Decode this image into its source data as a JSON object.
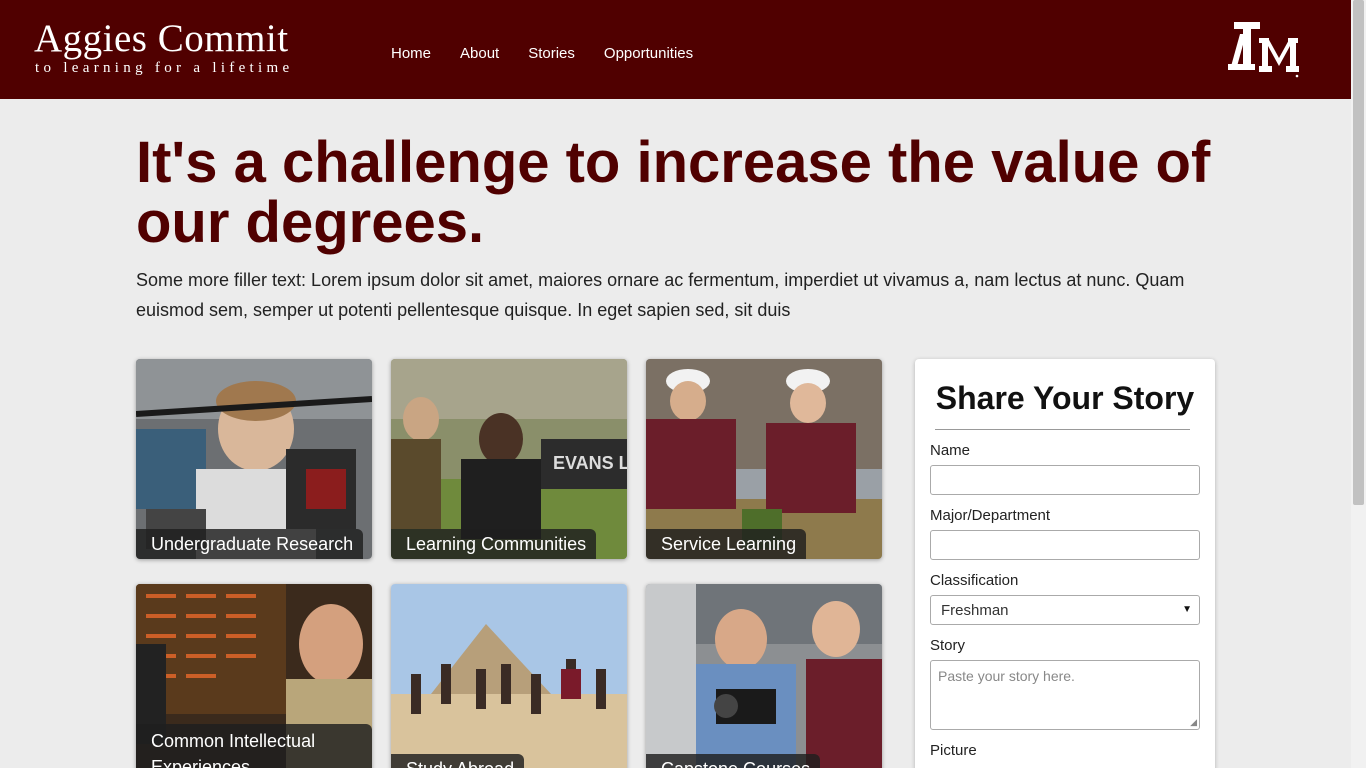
{
  "header": {
    "logo_title": "Aggies Commit",
    "logo_tagline": "to learning for a lifetime",
    "nav": [
      "Home",
      "About",
      "Stories",
      "Opportunities"
    ],
    "university_logo": "ATM",
    "brand_color": "#500000"
  },
  "hero": {
    "headline": "It's a challenge to increase the value of our degrees.",
    "lead": "Some more filler text: Lorem ipsum dolor sit amet, maiores ornare ac fermentum, imperdiet ut vivamus a, nam lectus at nunc. Quam euismod sem, semper ut potenti pellentesque quisque. In eget sapien sed, sit duis"
  },
  "tiles": [
    {
      "label": "Undergraduate Research",
      "icon": "photo-student-helicopter"
    },
    {
      "label": "Learning Communities",
      "icon": "photo-students-outdoors"
    },
    {
      "label": "Service Learning",
      "icon": "photo-students-hardhats"
    },
    {
      "label": "Common Intellectual Experiences",
      "icon": "photo-cadet-thinking"
    },
    {
      "label": "Study Abroad",
      "icon": "photo-pyramid-jump"
    },
    {
      "label": "Capstone Courses",
      "icon": "photo-lab-camera"
    }
  ],
  "form": {
    "title": "Share Your Story",
    "name_label": "Name",
    "major_label": "Major/Department",
    "classification_label": "Classification",
    "classification_value": "Freshman",
    "story_label": "Story",
    "story_placeholder": "Paste your story here.",
    "picture_label": "Picture"
  }
}
